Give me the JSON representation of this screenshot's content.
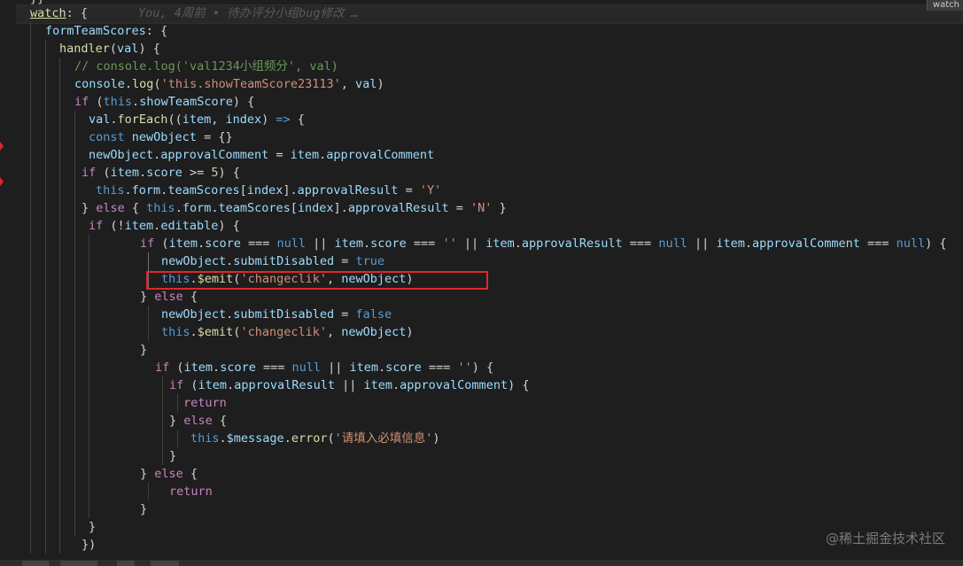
{
  "window": {
    "watch_badge": "watch",
    "top_fragment": "}}",
    "watermark": "@稀土掘金技术社区"
  },
  "editor": {
    "blame": "You, 4周前 • 待办评分小组bug修改 …",
    "code": {
      "watch": "watch",
      "formTeamScores": "formTeamScores",
      "handler": "handler",
      "val": "val",
      "comment": "// console.log('val1234小组频分', val)",
      "console": "console",
      "log": "log",
      "str_showTeamScore": "'this.showTeamScore23113'",
      "if": "if",
      "this": "this",
      "showTeamScore": "showTeamScore",
      "forEach": "forEach",
      "item": "item",
      "index": "index",
      "const": "const",
      "newObject": "newObject",
      "approvalComment": "approvalComment",
      "score": "score",
      "num_5": "5",
      "form": "form",
      "teamScores": "teamScores",
      "approvalResult": "approvalResult",
      "str_Y": "'Y'",
      "else": "else",
      "str_N": "'N'",
      "editable": "editable",
      "null": "null",
      "str_empty": "''",
      "submitDisabled": "submitDisabled",
      "true": "true",
      "false": "false",
      "emit": "$emit",
      "str_changeclik": "'changeclik'",
      "return": "return",
      "message": "$message",
      "error": "error",
      "str_required": "'请填入必填信息'"
    }
  },
  "colors": {
    "highlight_box": "#e0262c",
    "keyword": "#569cd6",
    "control": "#c586c0",
    "function": "#dcdcaa",
    "variable": "#9cdcfe",
    "string": "#ce9178",
    "comment": "#6a9955"
  }
}
